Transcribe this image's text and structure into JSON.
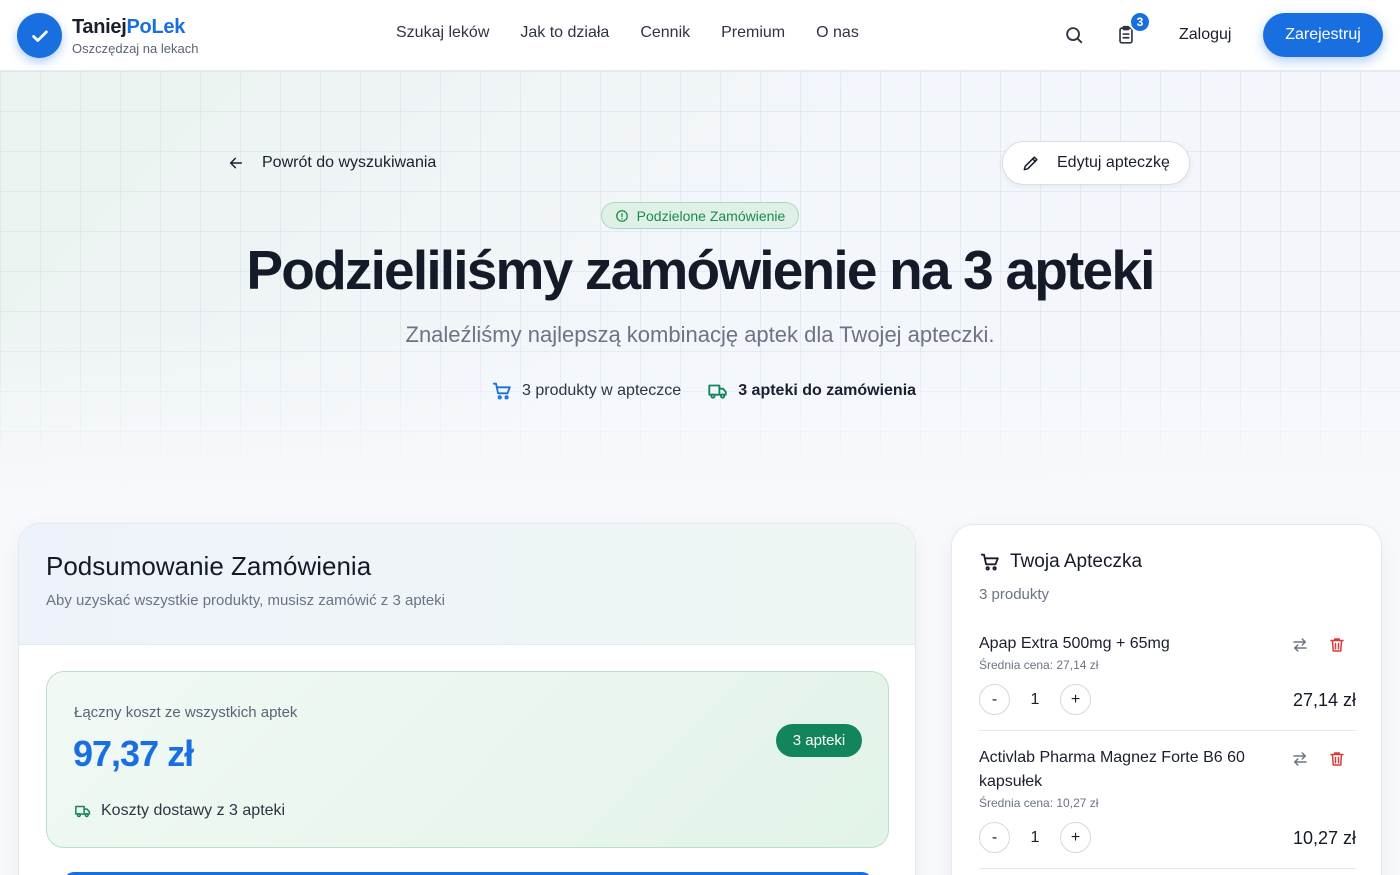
{
  "brand": {
    "name_a": "Taniej",
    "name_b": "PoLek",
    "tagline": "Oszczędzaj na lekach"
  },
  "nav": {
    "links": [
      "Szukaj leków",
      "Jak to działa",
      "Cennik",
      "Premium",
      "O nas"
    ],
    "cart_badge": "3",
    "login": "Zaloguj",
    "register": "Zarejestruj"
  },
  "hero": {
    "back": "Powrót do wyszukiwania",
    "edit": "Edytuj apteczkę",
    "pill": "Podzielone Zamówienie",
    "title": "Podzieliliśmy zamówienie na 3 apteki",
    "subtitle": "Znaleźliśmy najlepszą kombinację aptek dla Twojej apteczki.",
    "stat_products": "3 produkty w apteczce",
    "stat_pharmacies": "3 apteki do zamówienia"
  },
  "summary": {
    "title": "Podsumowanie Zamówienia",
    "subtitle": "Aby uzyskać wszystkie produkty, musisz zamówić z 3 apteki",
    "total_label": "Łączny koszt ze wszystkich aptek",
    "total_value": "97,37 zł",
    "badge": "3 apteki",
    "shipping": "Koszty dostawy z 3 apteki"
  },
  "cart": {
    "title": "Twoja Apteczka",
    "count": "3 produkty",
    "items": [
      {
        "name": "Apap Extra 500mg + 65mg",
        "avg": "Średnia cena: 27,14 zł",
        "qty": "1",
        "price": "27,14 zł"
      },
      {
        "name": "Activlab Pharma Magnez Forte B6 60 kapsułek",
        "avg": "Średnia cena: 10,27 zł",
        "qty": "1",
        "price": "10,27 zł"
      }
    ],
    "minus": "-",
    "plus": "+"
  },
  "colors": {
    "accent": "#1a6fe0",
    "success": "#13855a",
    "danger": "#d63a3a"
  }
}
